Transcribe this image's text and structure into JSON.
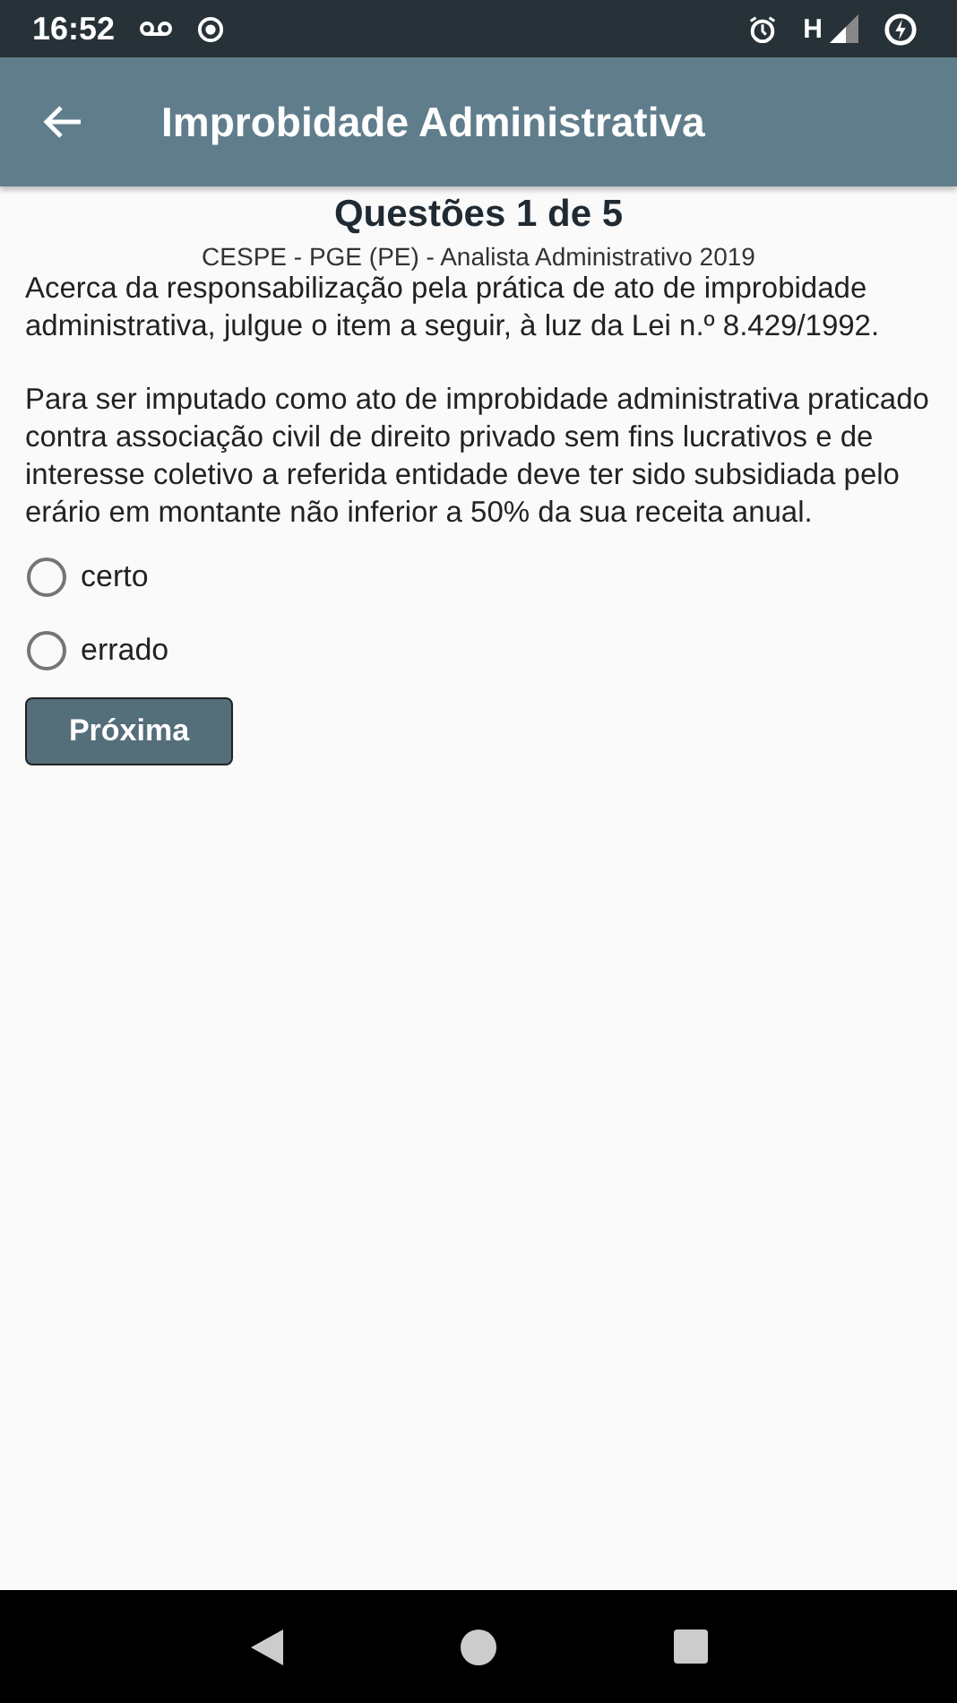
{
  "status_bar": {
    "time": "16:52",
    "network": "H"
  },
  "app_bar": {
    "title": "Improbidade Administrativa"
  },
  "question": {
    "counter": "Questões 1 de 5",
    "source": "CESPE - PGE (PE) - Analista Administrativo 2019",
    "paragraphs": [
      "Acerca da responsabilização pela prática de ato de improbidade administrativa, julgue o item a seguir, à luz da Lei n.º 8.429/1992.",
      "Para ser imputado como ato de improbidade administrativa praticado contra associação civil de direito privado sem fins lucrativos e de interesse coletivo a referida entidade deve ter sido subsidiada pelo erário em montante não inferior a 50% da sua receita anual."
    ],
    "options": [
      {
        "label": "certo",
        "selected": false
      },
      {
        "label": "errado",
        "selected": false
      }
    ],
    "next_button": "Próxima"
  }
}
